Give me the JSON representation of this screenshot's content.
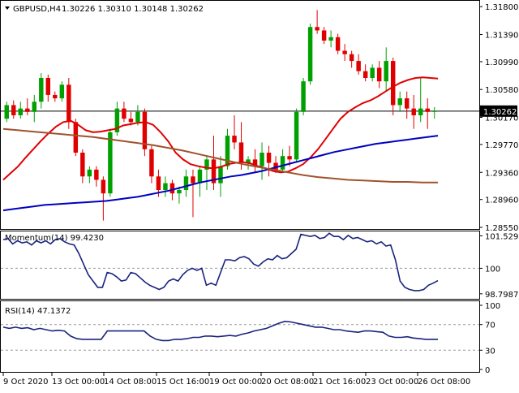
{
  "header": {
    "symbol_label": "GBPUSD,H4",
    "ohlc_text": "1.30226 1.30310 1.30148 1.30262"
  },
  "chart_data": [
    {
      "type": "candlestick",
      "panel": "price",
      "symbol": "GBPUSD",
      "timeframe": "H4",
      "ylim": [
        1.2855,
        1.3185
      ],
      "y_ticks": [
        "1.31800",
        "1.31390",
        "1.30990",
        "1.30580",
        "1.30170",
        "1.29770",
        "1.29360",
        "1.28960",
        "1.28550"
      ],
      "y_tick_values": [
        1.318,
        1.3139,
        1.3099,
        1.3058,
        1.3017,
        1.2977,
        1.2936,
        1.2896,
        1.2855
      ],
      "current_price_label": "1.30262",
      "current_price": 1.30262,
      "up_color": "#00a000",
      "down_color": "#e00000",
      "candles": [
        {
          "o": 1.3015,
          "h": 1.304,
          "l": 1.301,
          "c": 1.3035
        },
        {
          "o": 1.3035,
          "h": 1.3042,
          "l": 1.3015,
          "c": 1.302
        },
        {
          "o": 1.302,
          "h": 1.304,
          "l": 1.3015,
          "c": 1.303
        },
        {
          "o": 1.303,
          "h": 1.3045,
          "l": 1.302,
          "c": 1.3025
        },
        {
          "o": 1.3025,
          "h": 1.305,
          "l": 1.301,
          "c": 1.304
        },
        {
          "o": 1.304,
          "h": 1.3082,
          "l": 1.303,
          "c": 1.3075
        },
        {
          "o": 1.3075,
          "h": 1.308,
          "l": 1.304,
          "c": 1.305
        },
        {
          "o": 1.305,
          "h": 1.3055,
          "l": 1.304,
          "c": 1.3045
        },
        {
          "o": 1.3045,
          "h": 1.307,
          "l": 1.304,
          "c": 1.3065
        },
        {
          "o": 1.3065,
          "h": 1.3075,
          "l": 1.3,
          "c": 1.301
        },
        {
          "o": 1.301,
          "h": 1.3015,
          "l": 1.296,
          "c": 1.2965
        },
        {
          "o": 1.2965,
          "h": 1.297,
          "l": 1.292,
          "c": 1.293
        },
        {
          "o": 1.293,
          "h": 1.2945,
          "l": 1.292,
          "c": 1.294
        },
        {
          "o": 1.294,
          "h": 1.2945,
          "l": 1.2915,
          "c": 1.2925
        },
        {
          "o": 1.2925,
          "h": 1.293,
          "l": 1.2865,
          "c": 1.2905
        },
        {
          "o": 1.2905,
          "h": 1.3,
          "l": 1.29,
          "c": 1.2995
        },
        {
          "o": 1.2995,
          "h": 1.304,
          "l": 1.299,
          "c": 1.303
        },
        {
          "o": 1.303,
          "h": 1.304,
          "l": 1.301,
          "c": 1.3015
        },
        {
          "o": 1.3015,
          "h": 1.3025,
          "l": 1.3005,
          "c": 1.301
        },
        {
          "o": 1.301,
          "h": 1.3035,
          "l": 1.3005,
          "c": 1.3025
        },
        {
          "o": 1.3025,
          "h": 1.303,
          "l": 1.296,
          "c": 1.297
        },
        {
          "o": 1.297,
          "h": 1.2975,
          "l": 1.292,
          "c": 1.293
        },
        {
          "o": 1.293,
          "h": 1.294,
          "l": 1.29,
          "c": 1.291
        },
        {
          "o": 1.291,
          "h": 1.293,
          "l": 1.29,
          "c": 1.292
        },
        {
          "o": 1.292,
          "h": 1.2925,
          "l": 1.2895,
          "c": 1.2905
        },
        {
          "o": 1.2905,
          "h": 1.2915,
          "l": 1.289,
          "c": 1.291
        },
        {
          "o": 1.291,
          "h": 1.294,
          "l": 1.29,
          "c": 1.293
        },
        {
          "o": 1.293,
          "h": 1.294,
          "l": 1.287,
          "c": 1.292
        },
        {
          "o": 1.292,
          "h": 1.2945,
          "l": 1.29,
          "c": 1.294
        },
        {
          "o": 1.294,
          "h": 1.296,
          "l": 1.291,
          "c": 1.2955
        },
        {
          "o": 1.2955,
          "h": 1.299,
          "l": 1.291,
          "c": 1.292
        },
        {
          "o": 1.292,
          "h": 1.296,
          "l": 1.29,
          "c": 1.2945
        },
        {
          "o": 1.2945,
          "h": 1.3,
          "l": 1.294,
          "c": 1.299
        },
        {
          "o": 1.299,
          "h": 1.302,
          "l": 1.297,
          "c": 1.298
        },
        {
          "o": 1.298,
          "h": 1.301,
          "l": 1.294,
          "c": 1.295
        },
        {
          "o": 1.295,
          "h": 1.296,
          "l": 1.294,
          "c": 1.2955
        },
        {
          "o": 1.2955,
          "h": 1.297,
          "l": 1.2935,
          "c": 1.2945
        },
        {
          "o": 1.2945,
          "h": 1.298,
          "l": 1.2925,
          "c": 1.2965
        },
        {
          "o": 1.2965,
          "h": 1.2975,
          "l": 1.293,
          "c": 1.295
        },
        {
          "o": 1.295,
          "h": 1.296,
          "l": 1.2935,
          "c": 1.294
        },
        {
          "o": 1.294,
          "h": 1.297,
          "l": 1.2935,
          "c": 1.296
        },
        {
          "o": 1.296,
          "h": 1.2975,
          "l": 1.2945,
          "c": 1.2955
        },
        {
          "o": 1.2955,
          "h": 1.303,
          "l": 1.295,
          "c": 1.3025
        },
        {
          "o": 1.3025,
          "h": 1.3075,
          "l": 1.302,
          "c": 1.307
        },
        {
          "o": 1.307,
          "h": 1.3155,
          "l": 1.3065,
          "c": 1.315
        },
        {
          "o": 1.315,
          "h": 1.3175,
          "l": 1.314,
          "c": 1.3145
        },
        {
          "o": 1.3145,
          "h": 1.315,
          "l": 1.3125,
          "c": 1.313
        },
        {
          "o": 1.313,
          "h": 1.3145,
          "l": 1.312,
          "c": 1.3135
        },
        {
          "o": 1.3135,
          "h": 1.314,
          "l": 1.311,
          "c": 1.3115
        },
        {
          "o": 1.3115,
          "h": 1.3125,
          "l": 1.31,
          "c": 1.311
        },
        {
          "o": 1.311,
          "h": 1.3115,
          "l": 1.309,
          "c": 1.31
        },
        {
          "o": 1.31,
          "h": 1.311,
          "l": 1.308,
          "c": 1.3085
        },
        {
          "o": 1.3085,
          "h": 1.3095,
          "l": 1.307,
          "c": 1.3075
        },
        {
          "o": 1.3075,
          "h": 1.3095,
          "l": 1.307,
          "c": 1.309
        },
        {
          "o": 1.309,
          "h": 1.31,
          "l": 1.306,
          "c": 1.307
        },
        {
          "o": 1.307,
          "h": 1.312,
          "l": 1.3055,
          "c": 1.31
        },
        {
          "o": 1.31,
          "h": 1.3105,
          "l": 1.302,
          "c": 1.3035
        },
        {
          "o": 1.3035,
          "h": 1.3055,
          "l": 1.3025,
          "c": 1.3045
        },
        {
          "o": 1.3045,
          "h": 1.3055,
          "l": 1.3015,
          "c": 1.303
        },
        {
          "o": 1.303,
          "h": 1.305,
          "l": 1.3,
          "c": 1.302
        },
        {
          "o": 1.302,
          "h": 1.3075,
          "l": 1.301,
          "c": 1.303
        },
        {
          "o": 1.303,
          "h": 1.3045,
          "l": 1.3,
          "c": 1.3025
        },
        {
          "o": 1.3025,
          "h": 1.3032,
          "l": 1.3015,
          "c": 1.30262
        }
      ],
      "series": [
        {
          "name": "",
          "color": "#e00000",
          "values": [
            1.2925,
            1.2935,
            1.2945,
            1.2958,
            1.297,
            1.2982,
            1.2993,
            1.3003,
            1.301,
            1.3012,
            1.3006,
            1.2998,
            1.2995,
            1.2996,
            1.2998,
            1.3,
            1.3005,
            1.3007,
            1.3009,
            1.301,
            1.3006,
            1.2995,
            1.2982,
            1.2965,
            1.2955,
            1.2948,
            1.2945,
            1.2943,
            1.2942,
            1.2944,
            1.2948,
            1.295,
            1.2951,
            1.2949,
            1.2945,
            1.2942,
            1.2938,
            1.2936,
            1.2937,
            1.2942,
            1.2948,
            1.2958,
            1.297,
            1.2985,
            1.3,
            1.3015,
            1.3025,
            1.3032,
            1.3038,
            1.3042,
            1.3048,
            1.3055,
            1.3062,
            1.3068,
            1.3072,
            1.3075,
            1.3076,
            1.3075,
            1.3074
          ]
        },
        {
          "name": "",
          "color": "#0000c0",
          "values": [
            1.288,
            1.2882,
            1.2884,
            1.2886,
            1.2888,
            1.2889,
            1.289,
            1.2891,
            1.2892,
            1.2893,
            1.2894,
            1.2896,
            1.2898,
            1.29,
            1.2903,
            1.2906,
            1.2909,
            1.2913,
            1.2917,
            1.2921,
            1.2924,
            1.2927,
            1.293,
            1.2932,
            1.2935,
            1.2938,
            1.2942,
            1.2946,
            1.295,
            1.2954,
            1.2958,
            1.2962,
            1.2966,
            1.2969,
            1.2972,
            1.2975,
            1.2978,
            1.298,
            1.2982,
            1.2984,
            1.2986,
            1.2988,
            1.299
          ]
        },
        {
          "name": "",
          "color": "#a0522d",
          "values": [
            1.3,
            1.2998,
            1.2996,
            1.2994,
            1.2992,
            1.299,
            1.2988,
            1.2985,
            1.2982,
            1.2979,
            1.2976,
            1.2972,
            1.2968,
            1.2963,
            1.2958,
            1.2953,
            1.2948,
            1.2944,
            1.294,
            1.2936,
            1.2932,
            1.2929,
            1.2927,
            1.2925,
            1.2924,
            1.2923,
            1.2922,
            1.2922,
            1.2921,
            1.2921
          ]
        }
      ]
    },
    {
      "type": "line",
      "panel": "momentum",
      "title": "Momentum(14) 99.4230",
      "ylim": [
        98.6,
        101.7
      ],
      "y_ticks": [
        "101.5297",
        "100",
        "98.7987"
      ],
      "y_tick_values": [
        101.5297,
        100.0,
        98.7987
      ],
      "series": [
        {
          "name": "Momentum(14)",
          "color": "#1a237e",
          "values": [
            101.35,
            101.4,
            101.15,
            101.3,
            101.2,
            101.25,
            101.1,
            101.3,
            101.2,
            101.3,
            101.15,
            101.35,
            101.4,
            101.25,
            101.15,
            101.1,
            100.7,
            100.2,
            99.7,
            99.4,
            99.1,
            99.1,
            99.8,
            99.75,
            99.6,
            99.4,
            99.45,
            99.8,
            99.75,
            99.55,
            99.35,
            99.2,
            99.1,
            99.0,
            99.1,
            99.4,
            99.5,
            99.4,
            99.7,
            99.9,
            100.0,
            99.9,
            100.0,
            99.2,
            99.3,
            99.2,
            99.8,
            100.4,
            100.4,
            100.35,
            100.5,
            100.55,
            100.45,
            100.2,
            100.1,
            100.3,
            100.45,
            100.4,
            100.6,
            100.45,
            100.5,
            100.7,
            100.9,
            101.6,
            101.55,
            101.5,
            101.55,
            101.4,
            101.45,
            101.65,
            101.5,
            101.5,
            101.35,
            101.55,
            101.4,
            101.45,
            101.35,
            101.25,
            101.3,
            101.15,
            101.25,
            101.05,
            101.1,
            100.4,
            99.4,
            99.1,
            99.0,
            98.95,
            98.95,
            99.0,
            99.2,
            99.3,
            99.42
          ]
        }
      ]
    },
    {
      "type": "line",
      "panel": "rsi",
      "title": "RSI(14) 47.1372",
      "ylim": [
        0,
        100
      ],
      "y_ticks": [
        "100",
        "70",
        "30",
        "0"
      ],
      "y_tick_values": [
        100,
        70,
        30,
        0
      ],
      "series": [
        {
          "name": "RSI(14)",
          "color": "#1a237e",
          "values": [
            66,
            64,
            66,
            64,
            65,
            62,
            64,
            62,
            60,
            61,
            60,
            52,
            48,
            47,
            47,
            47,
            47,
            60,
            60,
            60,
            60,
            60,
            60,
            60,
            52,
            47,
            45,
            45,
            47,
            47,
            48,
            50,
            50,
            52,
            52,
            51,
            52,
            53,
            52,
            55,
            57,
            60,
            62,
            64,
            68,
            72,
            75,
            74,
            72,
            70,
            68,
            66,
            66,
            64,
            62,
            62,
            60,
            59,
            58,
            60,
            60,
            59,
            58,
            52,
            50,
            50,
            51,
            49,
            48,
            47,
            47,
            47
          ]
        }
      ]
    },
    {
      "type": "axis",
      "panel": "time-axis",
      "x_ticks": [
        "9 Oct 2020",
        "13 Oct 00:00",
        "14 Oct 08:00",
        "15 Oct 16:00",
        "19 Oct 00:00",
        "20 Oct 08:00",
        "21 Oct 16:00",
        "23 Oct 00:00",
        "26 Oct 08:00"
      ]
    }
  ]
}
